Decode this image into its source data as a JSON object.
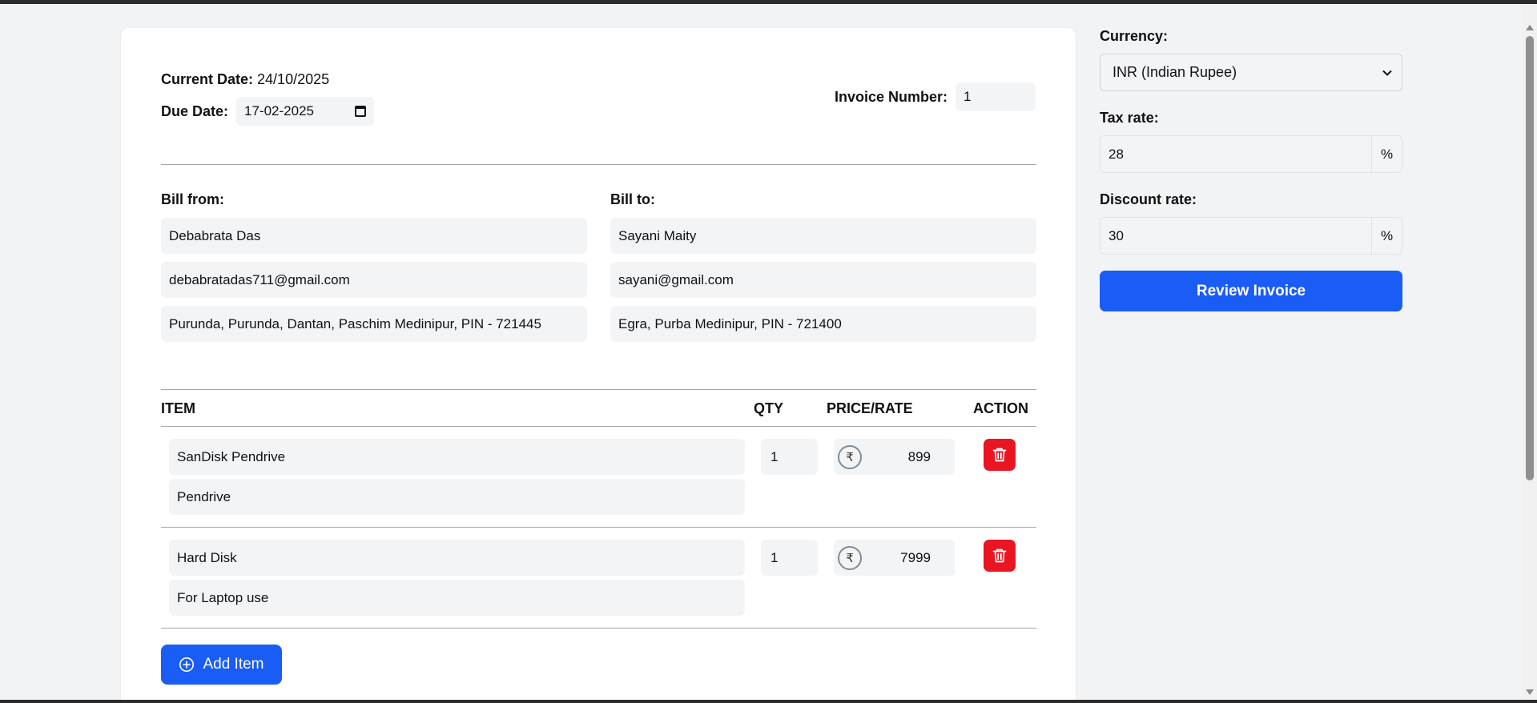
{
  "invoice": {
    "current_date_label": "Current Date:",
    "current_date_value": "24/10/2025",
    "due_date_label": "Due Date:",
    "due_date_value": "17-02-2025",
    "invoice_number_label": "Invoice Number:",
    "invoice_number_value": "1"
  },
  "bill_from": {
    "label": "Bill from:",
    "name": "Debabrata Das",
    "email": "debabratadas711@gmail.com",
    "address": "Purunda, Purunda, Dantan, Paschim Medinipur, PIN - 721445"
  },
  "bill_to": {
    "label": "Bill to:",
    "name": "Sayani Maity",
    "email": "sayani@gmail.com",
    "address": "Egra, Purba Medinipur, PIN - 721400"
  },
  "table": {
    "headers": [
      "ITEM",
      "QTY",
      "PRICE/RATE",
      "ACTION"
    ],
    "currency_symbol": "₹",
    "rows": [
      {
        "name": "SanDisk Pendrive",
        "description": "Pendrive",
        "qty": "1",
        "price": "899"
      },
      {
        "name": "Hard Disk",
        "description": "For Laptop use",
        "qty": "1",
        "price": "7999"
      }
    ]
  },
  "add_item_label": "Add Item",
  "side": {
    "currency_label": "Currency:",
    "currency_value": "INR (Indian Rupee)",
    "tax_label": "Tax rate:",
    "tax_value": "28",
    "discount_label": "Discount rate:",
    "discount_value": "30",
    "percent_symbol": "%",
    "review_label": "Review Invoice"
  },
  "colors": {
    "primary": "#1a5cf6",
    "danger": "#ea1522",
    "input_bg": "#f3f4f6",
    "page_bg": "#f2f3f5"
  },
  "icons": [
    "calendar-icon",
    "rupee-icon",
    "trash-icon",
    "plus-circle-icon",
    "chevron-down-icon"
  ]
}
